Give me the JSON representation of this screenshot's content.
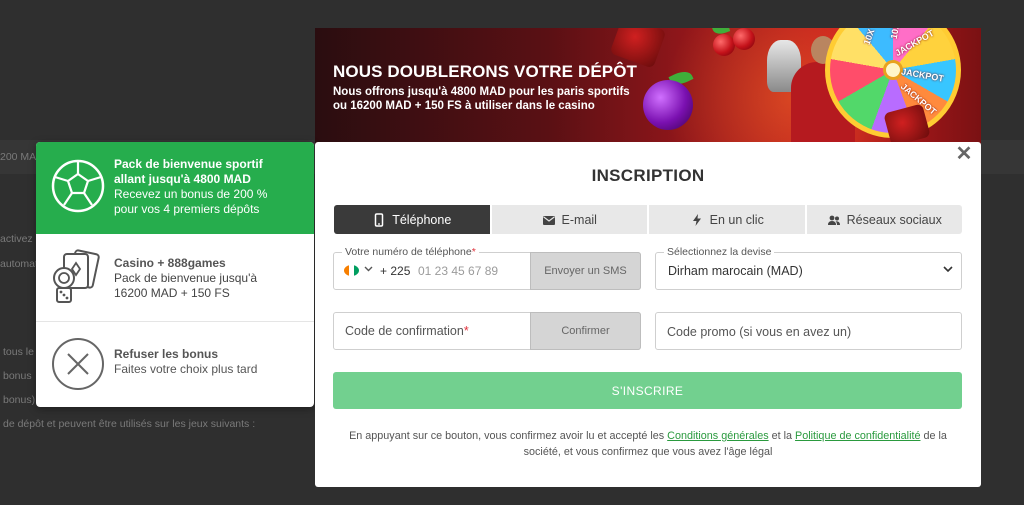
{
  "background": {
    "band_text": "200 MA",
    "lines": [
      "activez",
      "automati",
      "tous le",
      "bonus",
      "bonus)",
      "de dépôt et peuvent être utilisés sur les jeux suivants :"
    ]
  },
  "banner": {
    "title": "NOUS DOUBLERONS VOTRE DÉPÔT",
    "line1_pre": "Nous offrons jusqu'à ",
    "line1_amount": "4800 MAD",
    "line1_post": " pour les paris sportifs",
    "line2_pre": "ou ",
    "line2_amount": "16200 MAD + 150 FS",
    "line2_post": " à utiliser dans le casino",
    "wheel_labels": [
      "JACKPOT",
      "JACKPOT",
      "JACKPOT",
      "10X",
      "10X"
    ]
  },
  "bonus_panel": {
    "sport": {
      "title_line1": "Pack de bienvenue sportif",
      "title_line2": "allant jusqu'à 4800 MAD",
      "desc_line1": "Recevez un bonus de 200 %",
      "desc_line2": "pour vos 4 premiers dépôts"
    },
    "casino": {
      "title": "Casino + 888games",
      "desc_line1": "Pack de bienvenue jusqu'à",
      "desc_line2": "16200 MAD + 150 FS"
    },
    "refuse": {
      "title": "Refuser les bonus",
      "desc": "Faites votre choix plus tard"
    }
  },
  "modal": {
    "close": "✕",
    "title": "INSCRIPTION",
    "tabs": [
      {
        "label": "Téléphone",
        "icon": "phone-icon",
        "active": true
      },
      {
        "label": "E-mail",
        "icon": "envelope-icon",
        "active": false
      },
      {
        "label": "En un clic",
        "icon": "lightning-icon",
        "active": false
      },
      {
        "label": "Réseaux sociaux",
        "icon": "users-icon",
        "active": false
      }
    ],
    "phone": {
      "label": "Votre numéro de téléphone",
      "required_mark": "*",
      "dial_code": "+ 225",
      "placeholder": "01 23 45 67 89",
      "sms_button": "Envoyer un SMS",
      "flag_colors": [
        "#f77f00",
        "#ffffff",
        "#009e60"
      ]
    },
    "currency": {
      "label": "Sélectionnez la devise",
      "value": "Dirham marocain (MAD)"
    },
    "confirmation": {
      "placeholder": "Code de confirmation",
      "required_mark": "*",
      "button": "Confirmer"
    },
    "promo": {
      "placeholder": "Code promo (si vous en avez un)"
    },
    "submit": "S'INSCRIRE",
    "legal": {
      "pre": "En appuyant sur ce bouton, vous confirmez avoir lu et accepté les ",
      "link1": "Conditions générales",
      "mid": " et la ",
      "link2": "Politique de confidentialité",
      "post": " de la société, et vous confirmez que vous avez l'âge légal"
    }
  },
  "colors": {
    "accent_green": "#26ad4d",
    "submit_green": "#72d08f",
    "link_green": "#2a9a3e",
    "tab_active": "#3a3a3a",
    "required_red": "#e0323c"
  }
}
